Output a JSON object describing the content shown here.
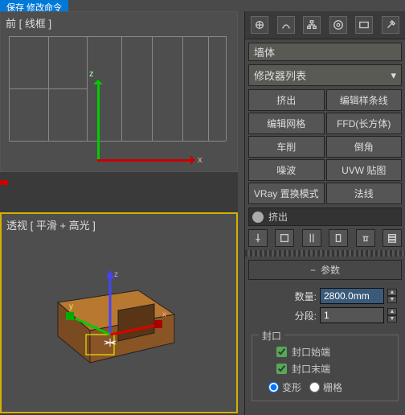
{
  "titlebar": {
    "tab": "保存 修改命令"
  },
  "viewports": {
    "top": {
      "label": "前 [ 线框 ]",
      "axis_x": "x",
      "axis_z": "z"
    },
    "bottom": {
      "label": "透视 [ 平滑 + 高光 ]",
      "axis_x": "x",
      "axis_y": "y",
      "axis_z": "z"
    }
  },
  "panel": {
    "object_name": "墙体",
    "modifier_dropdown": "修改器列表",
    "modifiers": [
      {
        "a": "挤出",
        "b": "编辑样条线"
      },
      {
        "a": "编辑网格",
        "b": "FFD(长方体)"
      },
      {
        "a": "车削",
        "b": "倒角"
      },
      {
        "a": "噪波",
        "b": "UVW 贴图"
      },
      {
        "a": "VRay 置换模式",
        "b": "法线"
      }
    ],
    "stack_item": "挤出",
    "rollout": "参数",
    "params": {
      "amount_label": "数量:",
      "amount_value": "2800.0mm",
      "segments_label": "分段:",
      "segments_value": "1"
    },
    "capping": {
      "legend": "封口",
      "start": "封口始端",
      "end": "封口末端",
      "morph": "变形",
      "grid": "栅格"
    }
  },
  "icons": {
    "top": [
      "create-icon",
      "modify-icon",
      "hierarchy-icon",
      "motion-icon",
      "display-icon",
      "utilities-icon"
    ],
    "tools": [
      "pin-icon",
      "config-icon",
      "show-icon",
      "make-unique-icon",
      "remove-icon",
      "stack-icon"
    ]
  }
}
